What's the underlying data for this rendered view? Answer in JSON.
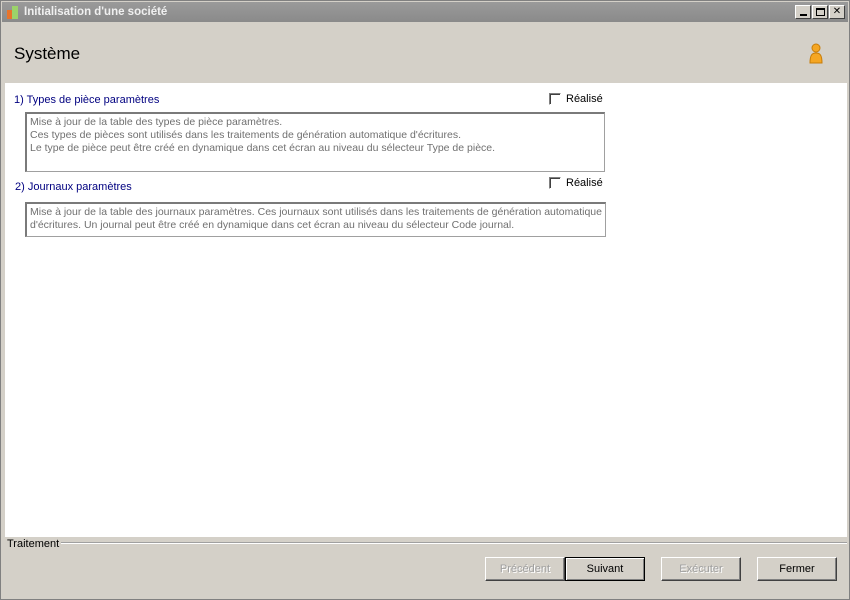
{
  "window": {
    "title": "Initialisation d'une société"
  },
  "header": {
    "title": "Système"
  },
  "steps": [
    {
      "title": "1) Types de pièce paramètres",
      "done_label": "Réalisé",
      "done": false,
      "description": [
        "Mise à jour de la table des types de pièce paramètres.",
        "Ces types de pièces sont utilisés dans les traitements de génération automatique d'écritures.",
        "Le type de pièce peut être créé en dynamique dans cet écran au niveau du sélecteur Type de pièce."
      ]
    },
    {
      "title": "2) Journaux paramètres",
      "done_label": "Réalisé",
      "done": false,
      "description": [
        "Mise à jour de la table des journaux paramètres. Ces journaux sont utilisés dans les traitements de génération automatique",
        "d'écritures. Un journal peut être créé en dynamique dans cet écran au niveau du sélecteur Code journal."
      ]
    }
  ],
  "footer": {
    "group_label": "Traitement",
    "buttons": {
      "previous": "Précédent",
      "next": "Suivant",
      "execute": "Exécuter",
      "close": "Fermer"
    }
  },
  "icons": {
    "app": "app-icon",
    "user": "user-icon"
  }
}
